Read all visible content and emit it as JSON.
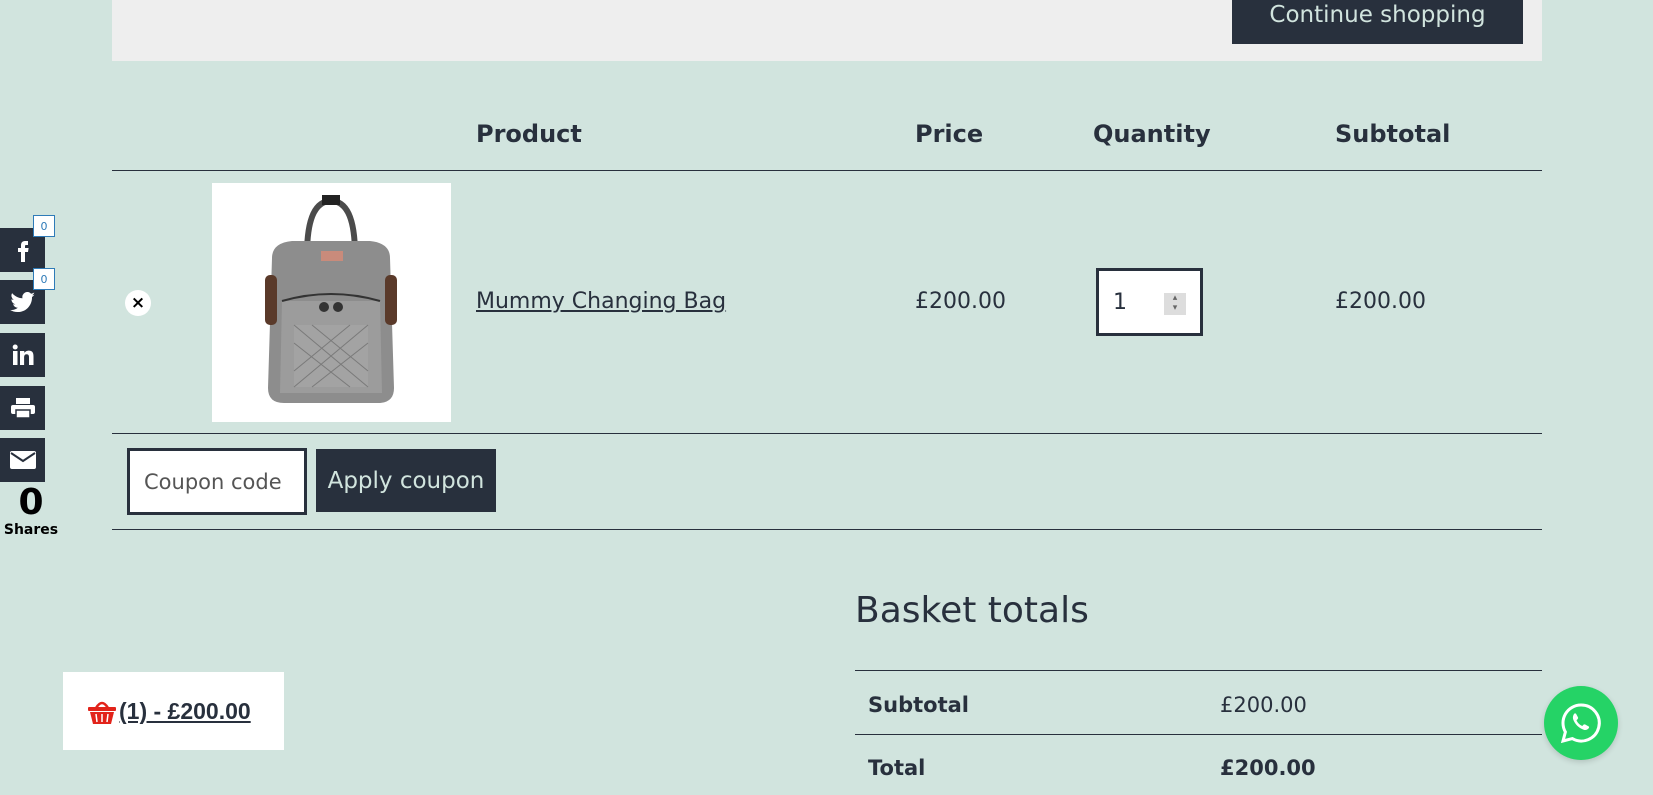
{
  "notice": {
    "continue_label": "Continue shopping"
  },
  "table": {
    "headers": {
      "product": "Product",
      "price": "Price",
      "quantity": "Quantity",
      "subtotal": "Subtotal"
    },
    "items": [
      {
        "remove_glyph": "×",
        "image_alt": "Mummy Changing Bag",
        "name": "Mummy Changing Bag",
        "price": "£200.00",
        "quantity": "1",
        "subtotal": "£200.00"
      }
    ]
  },
  "coupon": {
    "placeholder": "Coupon code",
    "apply_label": "Apply coupon"
  },
  "totals": {
    "title": "Basket totals",
    "subtotal_label": "Subtotal",
    "subtotal_value": "£200.00",
    "total_label": "Total",
    "total_value": "£200.00"
  },
  "share": {
    "facebook_count": "0",
    "twitter_count": "0",
    "total": "0",
    "total_label": "Shares"
  },
  "mini_cart": {
    "text": "(1) - £200.00"
  },
  "colors": {
    "background": "#d1e4de",
    "dark": "#28303d",
    "cart_red": "#e2231a",
    "whatsapp": "#25d366"
  }
}
